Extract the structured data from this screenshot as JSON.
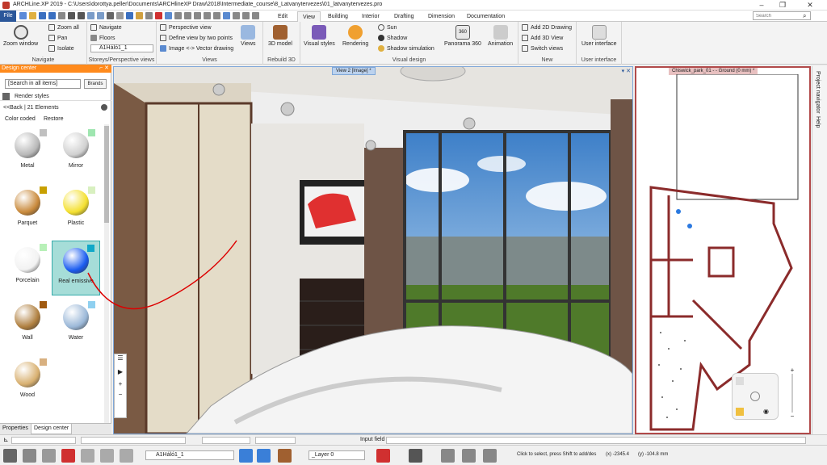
{
  "app": {
    "title": "ARCHLine.XP 2019 - C:\\Users\\dorottya.peller\\Documents\\ARCHlineXP Draw\\2018\\Intermediate_course\\8_Latvanytervezes\\01_latvanytervezes.pro"
  },
  "tabs": {
    "file": "File",
    "items": [
      "Edit",
      "View",
      "Building",
      "Interior",
      "Drafting",
      "Dimension",
      "Documentation"
    ],
    "active": "View"
  },
  "search": {
    "placeholder": "Search"
  },
  "ribbon": {
    "navigate": {
      "zoom_window": "Zoom window",
      "zoom_all": "Zoom all",
      "pan": "Pan",
      "isolate": "Isolate",
      "label": "Navigate"
    },
    "storeys": {
      "navigate": "Navigate",
      "floors": "Floors",
      "storey": "A1Háló1_1",
      "label": "Storeys/Perspective views"
    },
    "views": {
      "perspective": "Perspective view",
      "define": "Define view by two points",
      "image_vector": "Image <-> Vector drawing",
      "views": "Views",
      "label": "Views"
    },
    "rebuild": {
      "model": "3D model",
      "label": "Rebuild 3D"
    },
    "visual": {
      "styles": "Visual styles",
      "rendering": "Rendering",
      "sun": "Sun",
      "shadow": "Shadow",
      "shadow_sim": "Shadow simulation",
      "panorama": "Panorama 360",
      "animation": "Animation",
      "label": "Visual design"
    },
    "new": {
      "add2d": "Add 2D Drawing",
      "add3d": "Add 3D View",
      "switch": "Switch views",
      "label": "New"
    },
    "ui": {
      "btn": "User interface",
      "label": "User interface"
    }
  },
  "design_center": {
    "title": "Design center",
    "search": "[Search in all items]",
    "brands": "Brands",
    "breadcrumb": "Render styles",
    "back": "<<Back",
    "count": "21 Elements",
    "color_coded": "Color coded",
    "restore": "Restore",
    "materials": [
      {
        "name": "Metal",
        "ball": "#b8b8b8",
        "sw": "#c0c0c0"
      },
      {
        "name": "Mirror",
        "ball": "#d0d0d0",
        "sw": "#9fe6b0"
      },
      {
        "name": "Parquet",
        "ball": "#c98a3c",
        "sw": "#c8a000"
      },
      {
        "name": "Plastic",
        "ball": "#f4e030",
        "sw": "#d8f0c0"
      },
      {
        "name": "Porcelain",
        "ball": "#f2f2f2",
        "sw": "#b8f0b8"
      },
      {
        "name": "Real emissive",
        "ball": "#1a5cf0",
        "sw": "#10a8c8"
      },
      {
        "name": "Wall",
        "ball": "#b08040",
        "sw": "#a05a10"
      },
      {
        "name": "Water",
        "ball": "#9bb8d8",
        "sw": "#8fd0f0"
      },
      {
        "name": "Wood",
        "ball": "#d8b070",
        "sw": "#d8b080"
      }
    ],
    "tabs": [
      "Properties",
      "Design center"
    ]
  },
  "view_left": {
    "title": "View 2 [Image] *"
  },
  "view_right": {
    "title": "Chiswick_park_01 -  - Ground (0 mm) *"
  },
  "right_panel": [
    "Project navigator",
    "Help"
  ],
  "status": {
    "input_field": "Input field",
    "storey": "A1Háló1_1",
    "layer": "_Layer 0",
    "hint": "Click to select, press Shift to add/des",
    "x": "(x) -2345.4",
    "y": "(y) -104.8 mm"
  },
  "colors": {
    "accent": "#ff8a1c",
    "blue": "#2b579a",
    "plan": "#b14a4a"
  }
}
